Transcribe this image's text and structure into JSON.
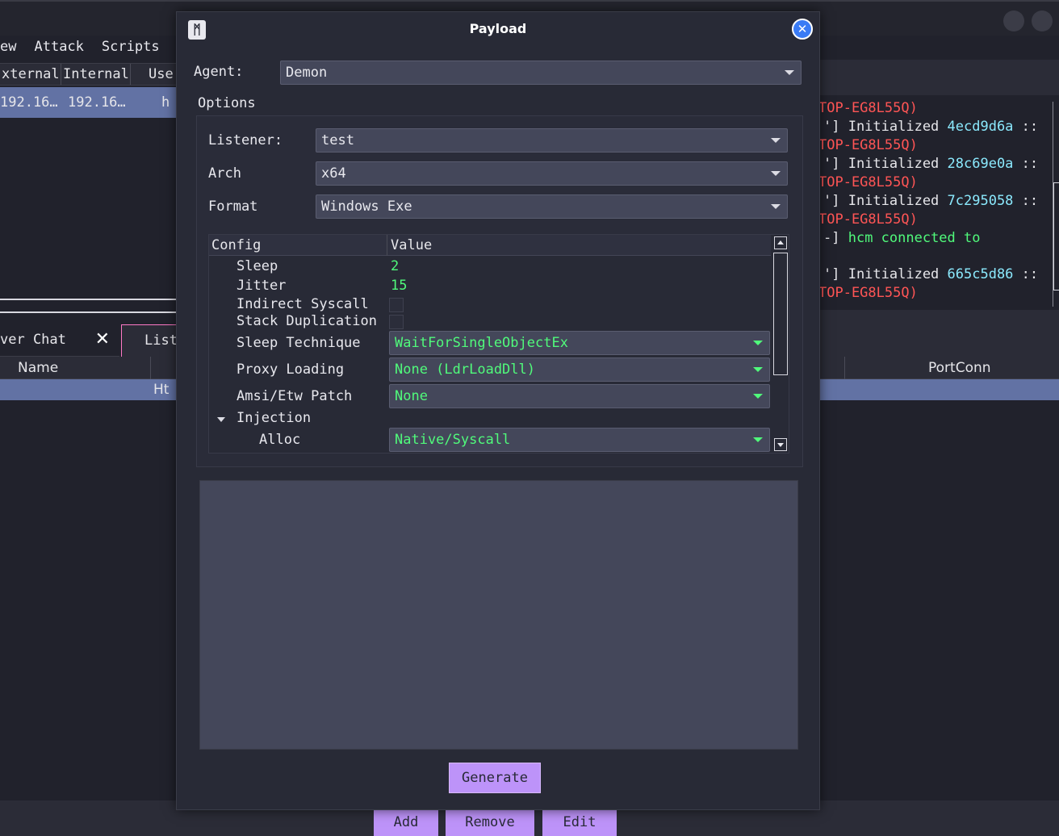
{
  "main_window": {
    "menu": [
      "ew",
      "Attack",
      "Scripts"
    ],
    "session_table": {
      "columns": [
        "xternal",
        "Internal",
        "Use"
      ],
      "row": [
        "192.16…",
        "192.16…",
        "h"
      ]
    },
    "tabs": {
      "chat_label": "ver Chat",
      "chat_close": "✕",
      "listeners_label": "List"
    },
    "listener_table": {
      "name_header": "Name",
      "portconn_header": "PortConn",
      "row_partial": "Ht"
    },
    "console_lines": [
      {
        "prefix": "",
        "text": "",
        "tail": "TOP-EG8L55Q)"
      },
      {
        "prefix": "'] Initialized ",
        "text": "4ecd9d6a",
        "tail": " ::"
      },
      {
        "prefix": "",
        "text": "",
        "tail": "TOP-EG8L55Q)"
      },
      {
        "prefix": "'] Initialized ",
        "text": "28c69e0a",
        "tail": " ::"
      },
      {
        "prefix": "",
        "text": "",
        "tail": "TOP-EG8L55Q)"
      },
      {
        "prefix": "'] Initialized ",
        "text": "7c295058",
        "tail": " ::"
      },
      {
        "prefix": "",
        "text": "",
        "tail": "TOP-EG8L55Q)"
      },
      {
        "prefix": "-] ",
        "text": "hcm connected to",
        "tail": ""
      },
      {
        "prefix": "'] Initialized ",
        "text": "665c5d86",
        "tail": " ::"
      },
      {
        "prefix": "",
        "text": "",
        "tail": "TOP-EG8L55Q)"
      }
    ],
    "bottom_buttons": [
      "Add",
      "Remove",
      "Edit"
    ]
  },
  "dialog": {
    "title": "Payload",
    "logo_glyph": "ᛗ",
    "close_glyph": "✕",
    "agent_label": "Agent:",
    "agent_value": "Demon",
    "options_label": "Options",
    "listener_label": "Listener:",
    "listener_value": "test",
    "arch_label": "Arch",
    "arch_value": "x64",
    "format_label": "Format",
    "format_value": "Windows Exe",
    "config_tree": {
      "col_config": "Config",
      "col_value": "Value",
      "sleep_label": "Sleep",
      "sleep_value": "2",
      "jitter_label": "Jitter",
      "jitter_value": "15",
      "indirect_syscall_label": "Indirect Syscall",
      "indirect_syscall_checked": false,
      "stack_duplication_label": "Stack Duplication",
      "stack_duplication_checked": false,
      "sleep_technique_label": "Sleep Technique",
      "sleep_technique_value": "WaitForSingleObjectEx",
      "proxy_loading_label": "Proxy Loading",
      "proxy_loading_value": "None (LdrLoadDll)",
      "amsi_label": "Amsi/Etw Patch",
      "amsi_value": "None",
      "injection_label": "Injection",
      "alloc_label": "Alloc",
      "alloc_value": "Native/Syscall"
    },
    "output_text": "",
    "generate_label": "Generate"
  },
  "colors": {
    "background": "#21222c",
    "panel": "#282a36",
    "input": "#44475a",
    "selection": "#6272a4",
    "accent_purple": "#bd93f9",
    "green": "#50fa7b",
    "red": "#ff5555",
    "cyan": "#8be9fd",
    "pink": "#ff79c6",
    "close_blue": "#3a7bf5"
  }
}
